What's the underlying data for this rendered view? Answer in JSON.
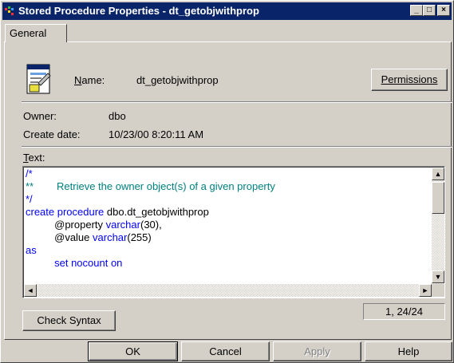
{
  "window": {
    "title": "Stored Procedure Properties - dt_getobjwithprop",
    "controls": {
      "minimize": "_",
      "maximize": "□",
      "close": "×"
    }
  },
  "tabs": [
    {
      "label": "General"
    }
  ],
  "name": {
    "label": "Name:",
    "value": "dt_getobjwithprop"
  },
  "permissions_button": "Permissions",
  "owner": {
    "label": "Owner:",
    "value": "dbo"
  },
  "create_date": {
    "label": "Create date:",
    "value": "10/23/00 8:20:11 AM"
  },
  "text_label": "Text:",
  "code": [
    [
      {
        "t": "/*",
        "c": "kw"
      }
    ],
    [
      {
        "t": "**",
        "c": "comment"
      },
      {
        "t": "        Retrieve the owner object(s) of a given property",
        "c": "comment"
      }
    ],
    [
      {
        "t": "*/",
        "c": "kw"
      }
    ],
    [
      {
        "t": "create procedure ",
        "c": "kw"
      },
      {
        "t": "dbo.dt_getobjwithprop",
        "c": "plain"
      }
    ],
    [
      {
        "t": "          @property ",
        "c": "plain"
      },
      {
        "t": "varchar",
        "c": "kw"
      },
      {
        "t": "(30),",
        "c": "plain"
      }
    ],
    [
      {
        "t": "          @value ",
        "c": "plain"
      },
      {
        "t": "varchar",
        "c": "kw"
      },
      {
        "t": "(255)",
        "c": "plain"
      }
    ],
    [
      {
        "t": "as",
        "c": "kw"
      }
    ],
    [
      {
        "t": "          set nocount on",
        "c": "kw"
      }
    ]
  ],
  "check_syntax_button": "Check Syntax",
  "cursor_position": "1, 24/24",
  "footer_buttons": {
    "ok": "OK",
    "cancel": "Cancel",
    "apply": "Apply",
    "help": "Help"
  },
  "colors": {
    "titlebar": "#0a246a",
    "comment": "#00807f",
    "keyword": "#0000ff",
    "face": "#d4d0c8"
  }
}
